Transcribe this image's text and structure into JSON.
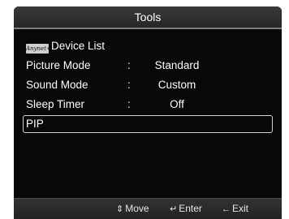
{
  "title": "Tools",
  "menu": {
    "device_list": {
      "logo_text": "Anynet+",
      "label": "Device List"
    },
    "picture_mode": {
      "label": "Picture Mode",
      "sep": ":",
      "value": "Standard"
    },
    "sound_mode": {
      "label": "Sound Mode",
      "sep": ":",
      "value": "Custom"
    },
    "sleep_timer": {
      "label": "Sleep Timer",
      "sep": ":",
      "value": "Off"
    },
    "pip": {
      "label": "PIP"
    }
  },
  "footer": {
    "move": {
      "icon": "updown-arrow-icon",
      "glyph": "⇕",
      "label": "Move"
    },
    "enter": {
      "icon": "enter-icon",
      "glyph": "↵",
      "label": "Enter"
    },
    "exit": {
      "icon": "exit-icon",
      "glyph": "←",
      "label": "Exit"
    }
  },
  "colors": {
    "background": "#080808",
    "text": "#ffffff",
    "selection_border": "#d0d0d0"
  }
}
